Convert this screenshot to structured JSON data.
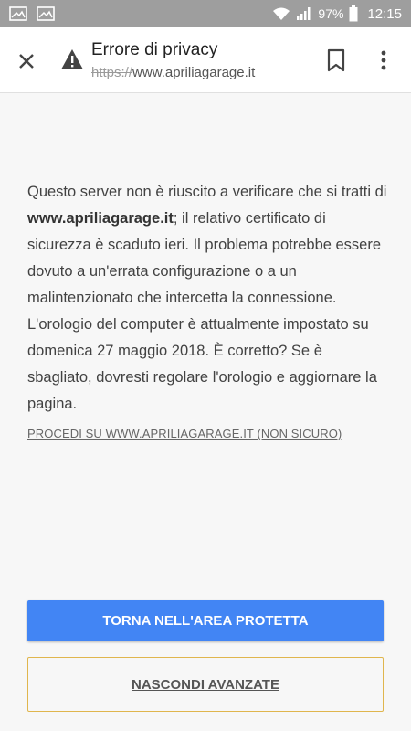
{
  "status_bar": {
    "battery": "97%",
    "time": "12:15"
  },
  "toolbar": {
    "title": "Errore di privacy",
    "url_scheme": "https://",
    "url_host": "www.apriliagarage.it"
  },
  "content": {
    "text_part1": "Questo server non è riuscito a verificare che si tratti di ",
    "domain_bold": "www.apriliagarage.it",
    "text_part2": "; il relativo certificato di sicurezza è scaduto ieri. Il problema potrebbe essere dovuto a un'errata configurazione o a un malintenzionato che intercetta la connessione. L'orologio del computer è attualmente impostato su domenica 27 maggio 2018. È corretto? Se è sbagliato, dovresti regolare l'orologio e aggiornare la pagina.",
    "proceed_link": "PROCEDI SU WWW.APRILIAGARAGE.IT (NON SICURO)"
  },
  "buttons": {
    "primary_label": "TORNA NELL'AREA PROTETTA",
    "secondary_label": "NASCONDI AVANZATE"
  },
  "colors": {
    "status_bar": "#9e9e9e",
    "primary_button": "#4285f4",
    "secondary_border": "#e0b64d"
  },
  "icons": [
    "image-icon",
    "image-icon",
    "wifi-icon",
    "signal-icon",
    "battery-icon",
    "close-icon",
    "warning-icon",
    "bookmark-icon",
    "more-vert-icon"
  ]
}
